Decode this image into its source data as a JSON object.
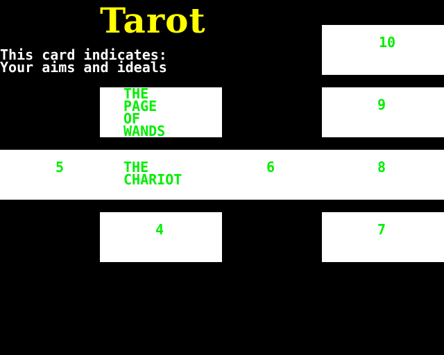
{
  "title": "Tarot",
  "caption": {
    "line1": "This card indicates:",
    "line2": "Your aims and ideals"
  },
  "cards": {
    "c10": "10",
    "c9": "9",
    "c8": "8",
    "c7": "7",
    "c6": "6",
    "c5": "5",
    "c4": "4",
    "page_of_wands": [
      "THE",
      "PAGE",
      "OF",
      "WANDS"
    ],
    "chariot": [
      "THE",
      "CHARIOT"
    ]
  },
  "colors": {
    "background": "#000000",
    "card": "#ffffff",
    "title": "#ffff00",
    "caption": "#ffffff",
    "card_text": "#00ee00"
  }
}
